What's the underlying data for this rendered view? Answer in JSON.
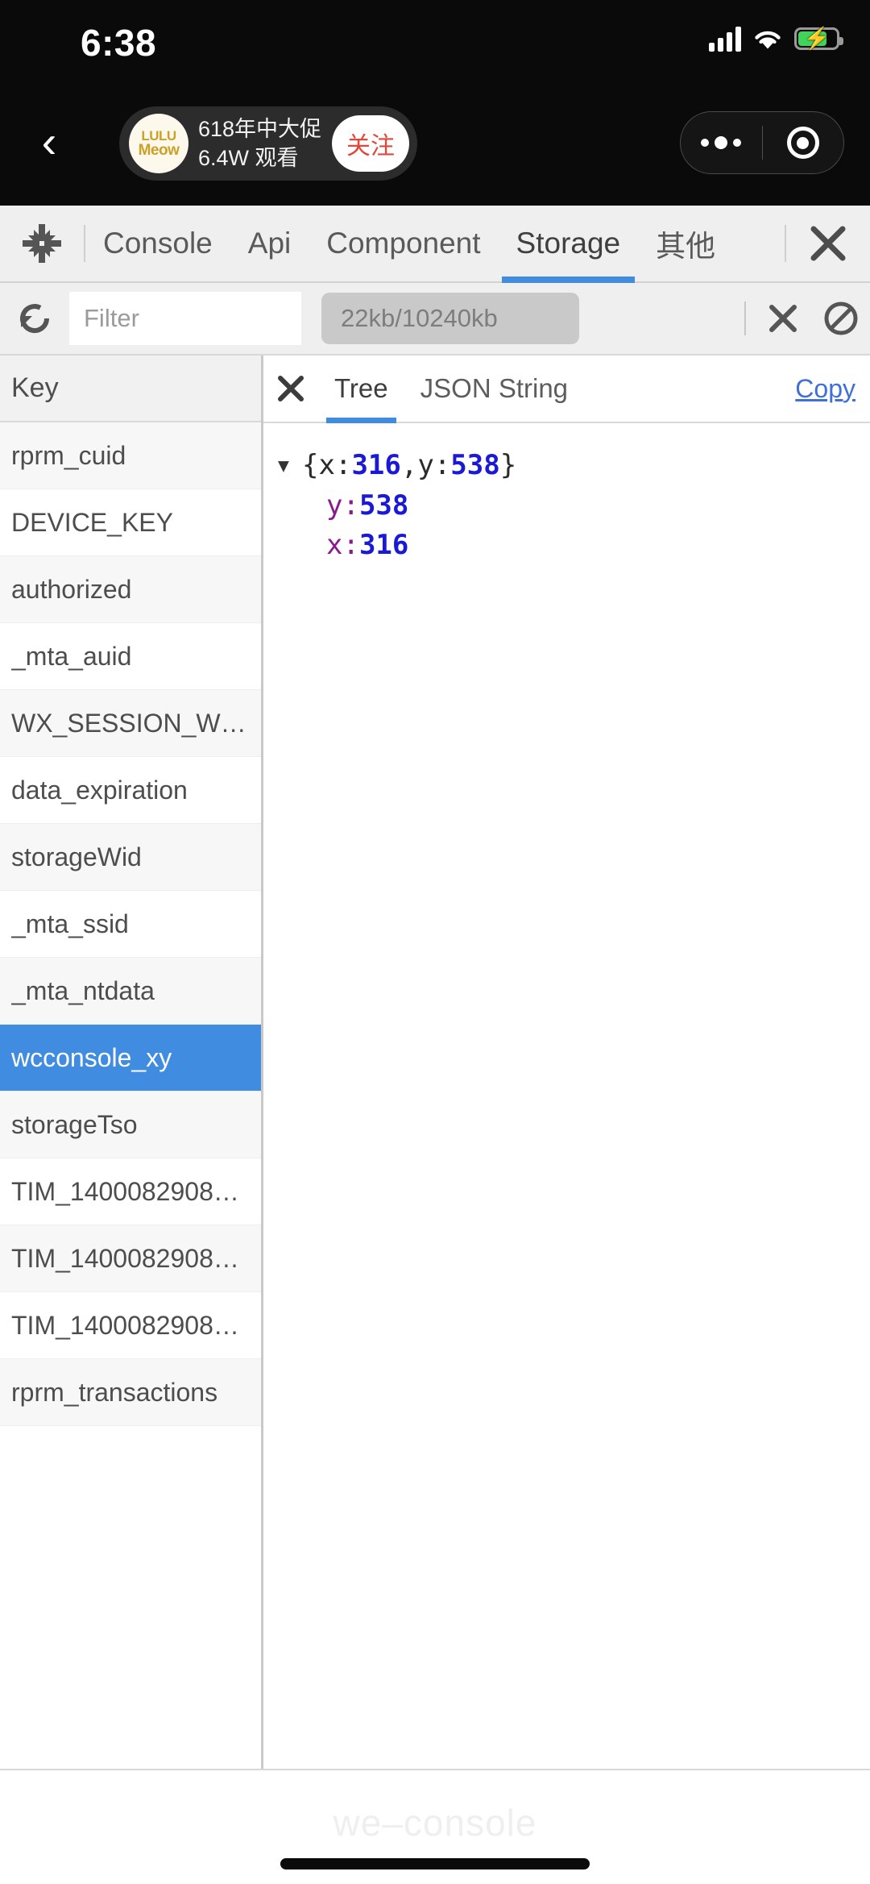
{
  "status_bar": {
    "time": "6:38",
    "signal_icon": "cellular-signal-icon",
    "wifi_icon": "wifi-icon",
    "battery_icon": "battery-charging-icon"
  },
  "live_header": {
    "back_icon": "back-chevron-icon",
    "avatar_line1": "LULU",
    "avatar_line2": "Meow",
    "title": "618年中大促",
    "viewers": "6.4W 观看",
    "follow_label": "关注",
    "capsule": {
      "more_icon": "more-dots-icon",
      "target_icon": "capsule-target-icon"
    }
  },
  "devtools": {
    "collapse_icon": "collapse-arrows-icon",
    "close_icon": "close-icon",
    "tabs": [
      {
        "label": "Console",
        "active": false
      },
      {
        "label": "Api",
        "active": false
      },
      {
        "label": "Component",
        "active": false
      },
      {
        "label": "Storage",
        "active": true
      },
      {
        "label": "其他",
        "active": false
      }
    ],
    "active_accent": "#3f8ce0"
  },
  "filter_bar": {
    "refresh_icon": "refresh-icon",
    "filter_value": "",
    "filter_placeholder": "Filter",
    "size_badge": "22kb/10240kb",
    "clear_icon": "close-icon",
    "block_icon": "no-entry-icon"
  },
  "key_panel": {
    "header": "Key",
    "selected_index": 9,
    "rows": [
      {
        "key": "rprm_cuid"
      },
      {
        "key": "DEVICE_KEY"
      },
      {
        "key": "authorized"
      },
      {
        "key": "_mta_auid"
      },
      {
        "key": "WX_SESSION_W…"
      },
      {
        "key": "data_expiration"
      },
      {
        "key": "storageWid"
      },
      {
        "key": "_mta_ssid"
      },
      {
        "key": "_mta_ntdata"
      },
      {
        "key": "wcconsole_xy"
      },
      {
        "key": "storageTso"
      },
      {
        "key": "TIM_1400082908…"
      },
      {
        "key": "TIM_1400082908…"
      },
      {
        "key": "TIM_1400082908…"
      },
      {
        "key": "rprm_transactions"
      }
    ],
    "selected_bg": "#3f8ce0"
  },
  "value_panel": {
    "close_icon": "close-icon",
    "tabs": [
      {
        "label": "Tree",
        "active": true
      },
      {
        "label": "JSON String",
        "active": false
      }
    ],
    "copy_label": "Copy",
    "tree": {
      "caret": "▼",
      "root_summary": {
        "open": "{",
        "k1": "x: ",
        "v1": "316",
        "sep": ", ",
        "k2": "y: ",
        "v2": "538",
        "close": "}"
      },
      "children": [
        {
          "key": "y: ",
          "value": "538"
        },
        {
          "key": "x: ",
          "value": "316"
        }
      ]
    },
    "key_color": "#8a1a8a",
    "value_color": "#1a1ad6"
  },
  "footer": {
    "watermark": "we–console",
    "home_indicator": "home-indicator"
  }
}
